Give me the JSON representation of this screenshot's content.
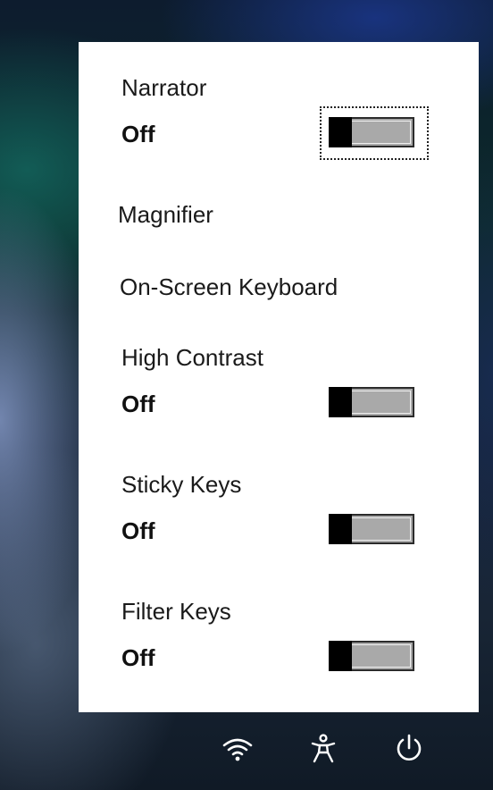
{
  "panel": {
    "narrator": {
      "title": "Narrator",
      "state": "Off"
    },
    "magnifier": {
      "label": "Magnifier"
    },
    "on_screen_keyboard": {
      "label": "On-Screen Keyboard"
    },
    "high_contrast": {
      "title": "High Contrast",
      "state": "Off"
    },
    "sticky_keys": {
      "title": "Sticky Keys",
      "state": "Off"
    },
    "filter_keys": {
      "title": "Filter Keys",
      "state": "Off"
    }
  },
  "bottom_bar": {
    "icons": [
      "wifi-icon",
      "ease-of-access-icon",
      "power-icon"
    ]
  },
  "colors": {
    "panel_bg": "#ffffff",
    "toggle_track": "#a9a9a9",
    "toggle_thumb": "#000000",
    "icon_color": "#ffffff"
  }
}
